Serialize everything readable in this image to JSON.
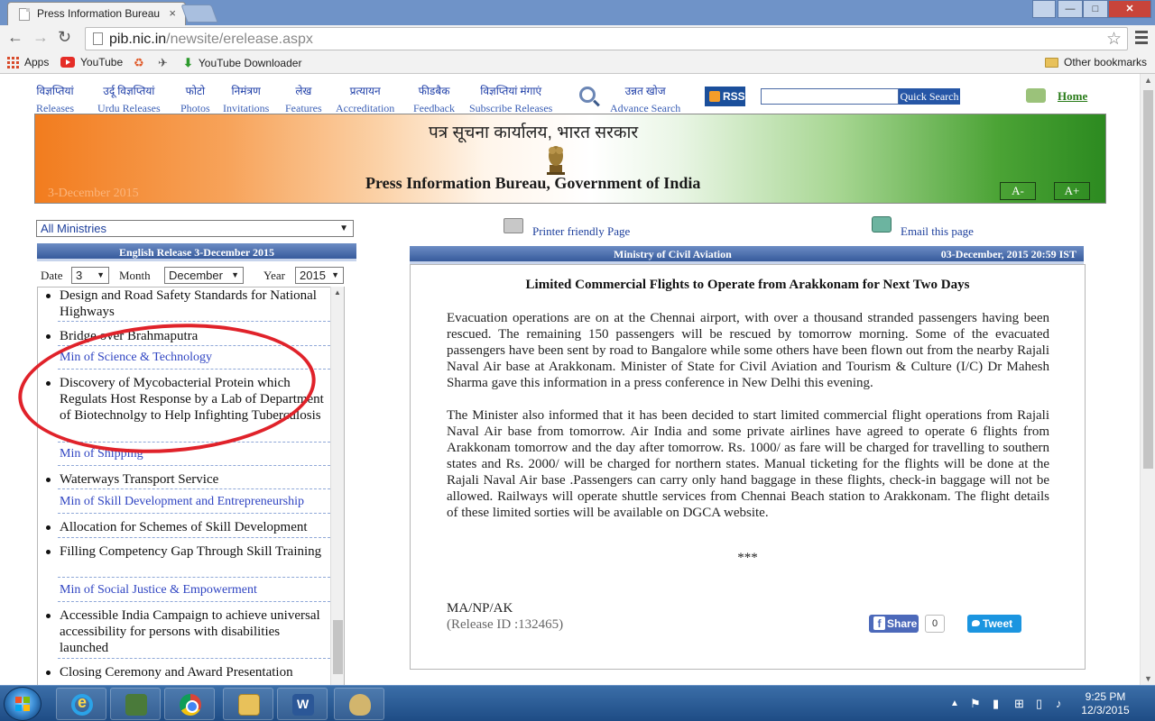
{
  "browser": {
    "tab_title": "Press Information Bureau",
    "tab_close": "×",
    "url_host": "pib.nic.in",
    "url_path": "/newsite/erelease.aspx",
    "window_buttons": {
      "minimize": "—",
      "maximize": "□",
      "close": "✕"
    },
    "bookmarks": [
      {
        "label": "Apps",
        "icon": "apps-icon"
      },
      {
        "label": "YouTube",
        "icon": "youtube-icon"
      },
      {
        "label": "",
        "icon": "extension-icon"
      },
      {
        "label": "",
        "icon": "extension-icon"
      },
      {
        "label": "YouTube Downloader",
        "icon": "download-icon"
      }
    ],
    "other_bookmarks": "Other bookmarks"
  },
  "nav": [
    {
      "hi": "विज्ञप्तियां",
      "en": "Releases"
    },
    {
      "hi": "उर्दू विज्ञप्तियां",
      "en": "Urdu Releases"
    },
    {
      "hi": "फोटो",
      "en": "Photos"
    },
    {
      "hi": "निमंत्रण",
      "en": "Invitations"
    },
    {
      "hi": "लेख",
      "en": "Features"
    },
    {
      "hi": "प्रत्यायन",
      "en": "Accreditation"
    },
    {
      "hi": "फीडबैक",
      "en": "Feedback"
    },
    {
      "hi": "विज्ञप्तियां मंगाएं",
      "en": "Subscribe Releases"
    },
    {
      "hi": "उन्नत खोज",
      "en": "Advance Search"
    }
  ],
  "rss_label": "RSS",
  "quick_search": {
    "value": "",
    "button": "Quick Search"
  },
  "home_link": "Home",
  "banner": {
    "title_hi": "पत्र सूचना कार्यालय, भारत सरकार",
    "title_en": "Press Information Bureau, Government of India",
    "date": "3-December 2015",
    "font_minus": "A-",
    "font_plus": "A+"
  },
  "sidebar": {
    "ministry_select": "All Ministries",
    "header": "English Release 3-December 2015",
    "date_label": "Date",
    "date_value": "3",
    "month_label": "Month",
    "month_value": "December",
    "year_label": "Year",
    "year_value": "2015",
    "items": [
      {
        "type": "release",
        "text": "Design and Road Safety Standards for National Highways"
      },
      {
        "type": "release",
        "text": "Bridge over Brahmaputra"
      },
      {
        "type": "ministry",
        "text": "Min of Science & Technology"
      },
      {
        "type": "release",
        "text": "Discovery of Mycobacterial Protein which Regulats Host Response by a Lab of Department of Biotechnolgy to Help Infighting Tuberculosis"
      },
      {
        "type": "ministry",
        "text": "Min of Shipping"
      },
      {
        "type": "release",
        "text": "Waterways Transport Service"
      },
      {
        "type": "ministry",
        "text": "Min of Skill Development and Entrepreneurship"
      },
      {
        "type": "release",
        "text": "Allocation for Schemes of Skill Development"
      },
      {
        "type": "release",
        "text": "Filling Competency Gap Through Skill Training"
      },
      {
        "type": "ministry",
        "text": "Min of Social Justice & Empowerment"
      },
      {
        "type": "release",
        "text": "Accessible India Campaign to achieve universal accessibility for persons with disabilities launched"
      },
      {
        "type": "release",
        "text": "Closing Ceremony and Award Presentation"
      }
    ]
  },
  "article": {
    "printer_link": "Printer friendly Page",
    "email_link": "Email this page",
    "ministry": "Ministry of Civil Aviation",
    "datetime": "03-December, 2015 20:59 IST",
    "title": "Limited Commercial Flights to Operate from Arakkonam for Next Two Days",
    "paragraphs": [
      "Evacuation operations are on at the Chennai airport, with over a thousand stranded passengers having been rescued. The remaining 150 passengers will be rescued by tomorrow morning. Some of the evacuated passengers have been sent by road to Bangalore while some others have been flown out from the nearby Rajali Naval Air base at Arakkonam. Minister of State for Civil Aviation and Tourism & Culture (I/C) Dr Mahesh Sharma gave this information in a press conference in New Delhi this evening.",
      "The Minister also informed that it has been decided to start limited commercial flight operations from Rajali Naval Air base from tomorrow. Air India and some private airlines have agreed to operate 6 flights from Arakkonam tomorrow and the day after tomorrow. Rs. 1000/ as fare will be charged for travelling to southern states and Rs. 2000/ will be charged for northern states. Manual ticketing for the flights will be done at the Rajali Naval Air base .Passengers can carry only hand baggage in these flights, check-in baggage will not be allowed. Railways will operate shuttle services from Chennai Beach station to Arakkonam. The flight details of these limited sorties will be available on DGCA website."
    ],
    "stars": "***",
    "signature": "MA/NP/AK",
    "release_id": "(Release ID :132465)",
    "share_label": "Share",
    "share_count": "0",
    "tweet_label": "Tweet"
  },
  "taskbar": {
    "time": "9:25 PM",
    "date": "12/3/2015"
  },
  "colors": {
    "nav_link": "#1f3fa8",
    "header_bar": "#375b9c",
    "ministry_link": "#2f44c2",
    "highlight_ellipse": "#e0222a",
    "saffron": "#f27c1e",
    "green": "#2c8a20"
  }
}
